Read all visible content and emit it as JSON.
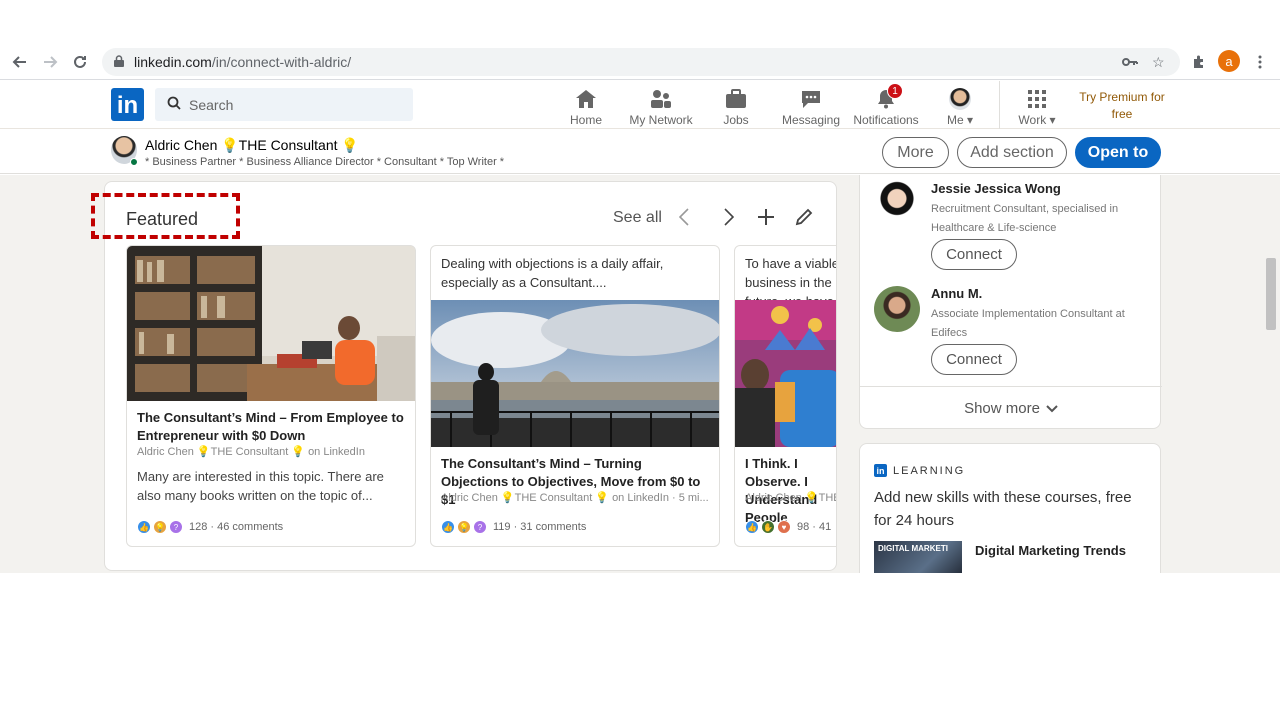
{
  "browser": {
    "url_host": "linkedin.com",
    "url_path": "/in/connect-with-aldric/",
    "profile_initial": "a"
  },
  "linkedin_nav": {
    "logo": "in",
    "search_placeholder": "Search",
    "items": [
      {
        "label": "Home",
        "icon": "home-icon"
      },
      {
        "label": "My Network",
        "icon": "network-icon"
      },
      {
        "label": "Jobs",
        "icon": "briefcase-icon"
      },
      {
        "label": "Messaging",
        "icon": "messaging-icon"
      },
      {
        "label": "Notifications",
        "icon": "bell-icon",
        "badge": "1"
      },
      {
        "label": "Me",
        "icon": "avatar-icon"
      },
      {
        "label": "Work",
        "icon": "grid-icon"
      }
    ],
    "premium_label": "Try Premium for free"
  },
  "profile_header": {
    "name": "Aldric Chen 💡THE Consultant 💡",
    "headline": "* Business Partner * Business Alliance Director * Consultant * Top Writer *",
    "more_label": "More",
    "add_section_label": "Add section",
    "open_to_label": "Open to"
  },
  "featured": {
    "title": "Featured",
    "see_all": "See all",
    "cards": [
      {
        "title": "The Consultant’s Mind – From Employee to Entrepreneur with $0 Down",
        "author": "Aldric Chen 💡THE Consultant 💡 on LinkedIn",
        "description": "Many are interested in this topic. There are also many books written on the topic of...",
        "reactions": "128 · 46 comments"
      },
      {
        "snippet": "Dealing with objections is a daily affair, especially as a Consultant....",
        "title": "The Consultant’s Mind – Turning Objections to Objectives, Move from $0 to $1",
        "author": "Aldric Chen 💡THE Consultant 💡 on LinkedIn · 5 mi...",
        "reactions": "119 · 31 comments"
      },
      {
        "snippet": "To have a viable business in the future, we have",
        "title": "I Think. I Observe. I Understand People",
        "author": "Aldric Chen 💡THE Consultant",
        "reactions": "98 · 41"
      }
    ]
  },
  "suggestions": {
    "people": [
      {
        "name": "Jessie Jessica Wong",
        "description": "Recruitment Consultant, specialised in Healthcare & Life-science",
        "action": "Connect"
      },
      {
        "name": "Annu M.",
        "description": "Associate Implementation Consultant at Edifecs",
        "action": "Connect"
      }
    ],
    "show_more": "Show more"
  },
  "learning": {
    "heading": "LEARNING",
    "text": "Add new skills with these courses, free for 24 hours",
    "thumb_text": "DIGITAL MARKETI",
    "course": "Digital Marketing Trends"
  }
}
